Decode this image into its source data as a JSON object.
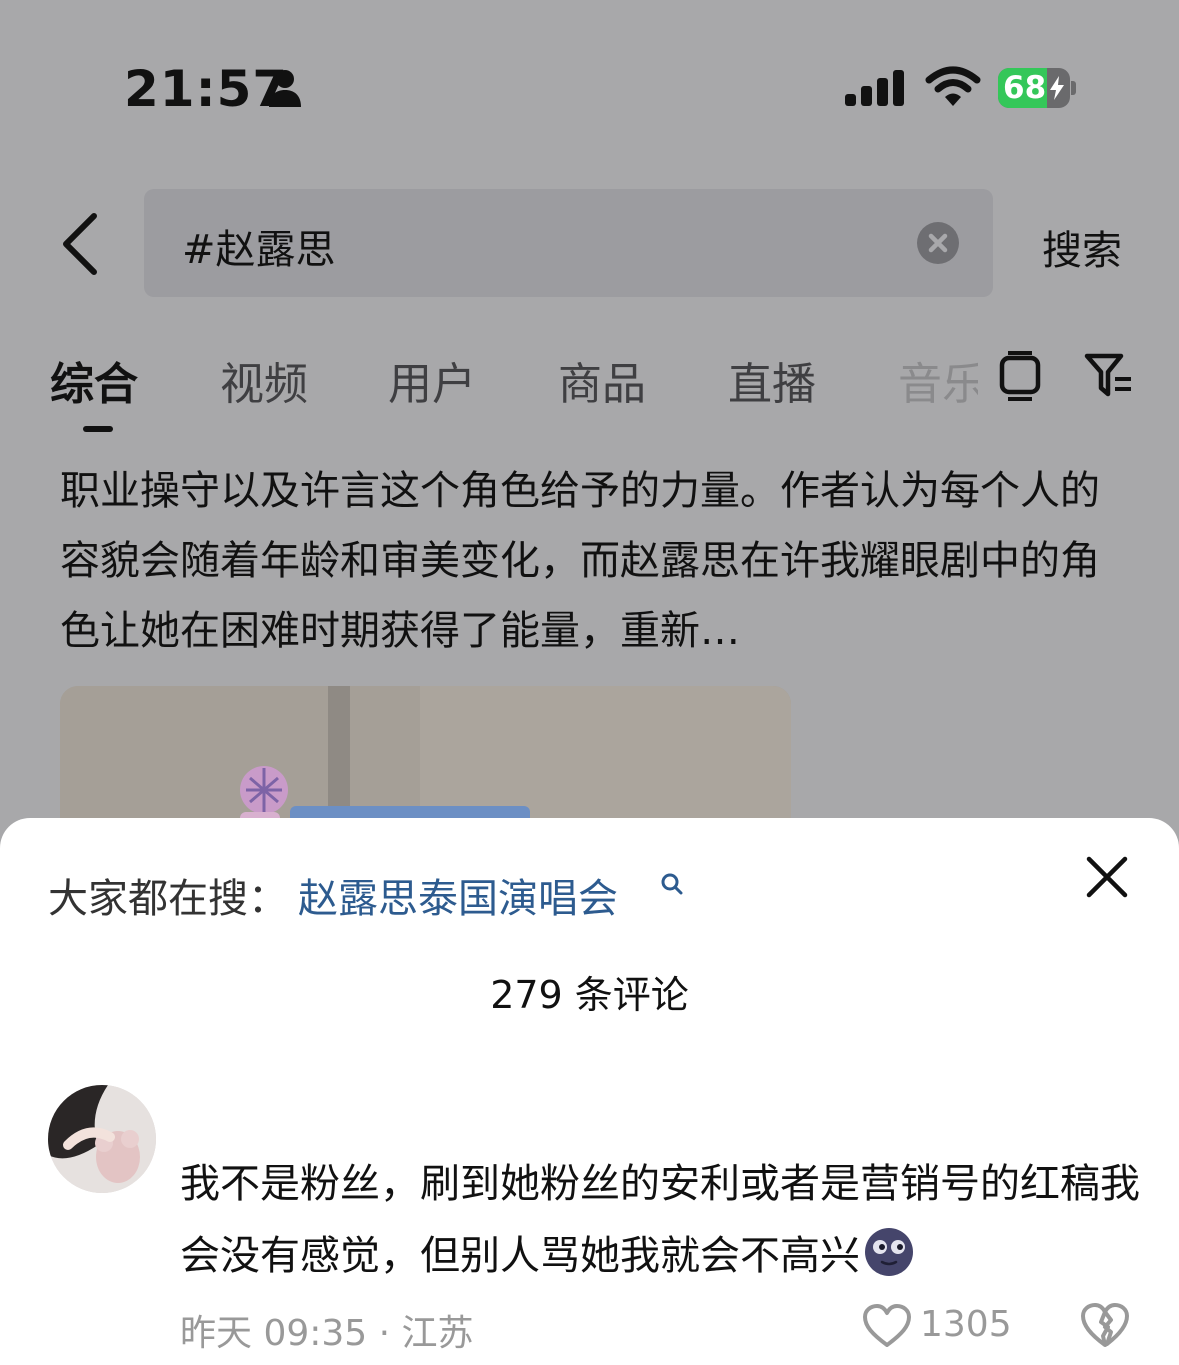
{
  "status_bar": {
    "time": "21:57",
    "battery": "68",
    "battery_level": 0.68,
    "icons": [
      "person-icon",
      "signal-icon",
      "wifi-icon",
      "battery-charging-icon"
    ]
  },
  "search": {
    "query": "#赵露思",
    "submit_label": "搜索"
  },
  "tabs": [
    {
      "label": "综合",
      "active": true
    },
    {
      "label": "视频"
    },
    {
      "label": "用户"
    },
    {
      "label": "商品"
    },
    {
      "label": "直播"
    },
    {
      "label": "音乐"
    }
  ],
  "article": {
    "text": "职业操守以及许言这个角色给予的力量。作者认为每个人的容貌会随着年龄和审美变化，而赵露思在许我耀眼剧中的角色让她在困难时期获得了能量，重新…"
  },
  "comment_sheet": {
    "trending_prefix": "大家都在搜：",
    "trending_term": "赵露思泰国演唱会",
    "comments_count": "279 条评论",
    "comments": [
      {
        "text": "我不是粉丝，刷到她粉丝的安利或者是营销号的红稿我会没有感觉，但别人骂她我就会不高兴",
        "emoji": "new-moon-face-icon",
        "meta": "昨天 09:35 · 江苏",
        "likes": "1305"
      }
    ]
  },
  "colors": {
    "overlay_bg": "#a8a8aa",
    "link": "#2d5b8f",
    "battery_green": "#34c759"
  }
}
